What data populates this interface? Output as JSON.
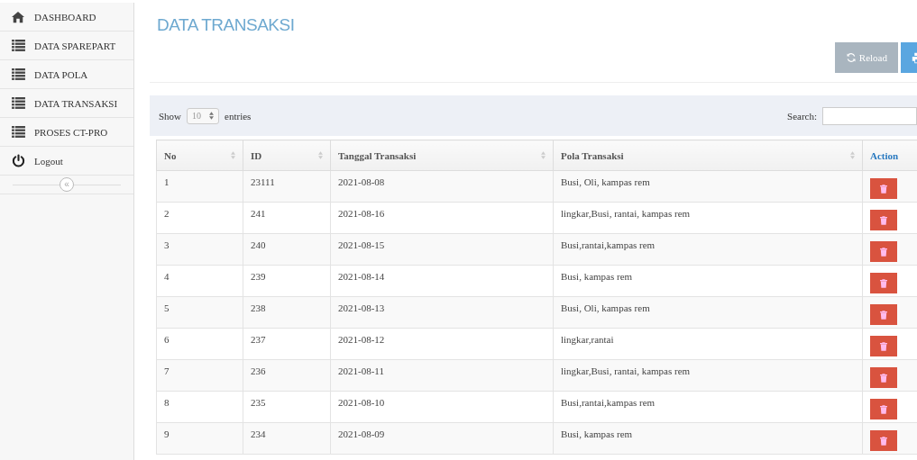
{
  "sidebar": {
    "items": [
      {
        "label": "DASHBOARD",
        "kind": "home"
      },
      {
        "label": "DATA SPAREPART",
        "kind": "list"
      },
      {
        "label": "DATA POLA",
        "kind": "list"
      },
      {
        "label": "DATA TRANSAKSI",
        "kind": "list"
      },
      {
        "label": "PROSES CT-PRO",
        "kind": "list"
      },
      {
        "label": "Logout",
        "kind": "power"
      }
    ],
    "collapse": "«"
  },
  "page": {
    "title": "DATA TRANSAKSI"
  },
  "toolbar": {
    "buttons": [
      {
        "label": "Reload",
        "kind": "reload"
      },
      {
        "kind": "print"
      }
    ]
  },
  "table": {
    "length": {
      "show": "Show",
      "value": "10",
      "entries": "entries"
    },
    "search_label": "Search:",
    "columns": [
      {
        "label": "No",
        "sortable": true
      },
      {
        "label": "ID",
        "sortable": true
      },
      {
        "label": "Tanggal Transaksi",
        "sortable": true
      },
      {
        "label": "Pola Transaksi",
        "sortable": true
      },
      {
        "label": "Action",
        "sortable": false
      }
    ],
    "rows": [
      [
        "1",
        "23111",
        "2021-08-08",
        "Busi, Oli, kampas rem"
      ],
      [
        "2",
        "241",
        "2021-08-16",
        "lingkar,Busi, rantai, kampas rem"
      ],
      [
        "3",
        "240",
        "2021-08-15",
        "Busi,rantai,kampas rem"
      ],
      [
        "4",
        "239",
        "2021-08-14",
        "Busi, kampas rem"
      ],
      [
        "5",
        "238",
        "2021-08-13",
        "Busi, Oli, kampas rem"
      ],
      [
        "6",
        "237",
        "2021-08-12",
        "lingkar,rantai"
      ],
      [
        "7",
        "236",
        "2021-08-11",
        "lingkar,Busi, rantai, kampas rem"
      ],
      [
        "8",
        "235",
        "2021-08-10",
        "Busi,rantai,kampas rem"
      ],
      [
        "9",
        "234",
        "2021-08-09",
        "Busi, kampas rem"
      ]
    ]
  }
}
